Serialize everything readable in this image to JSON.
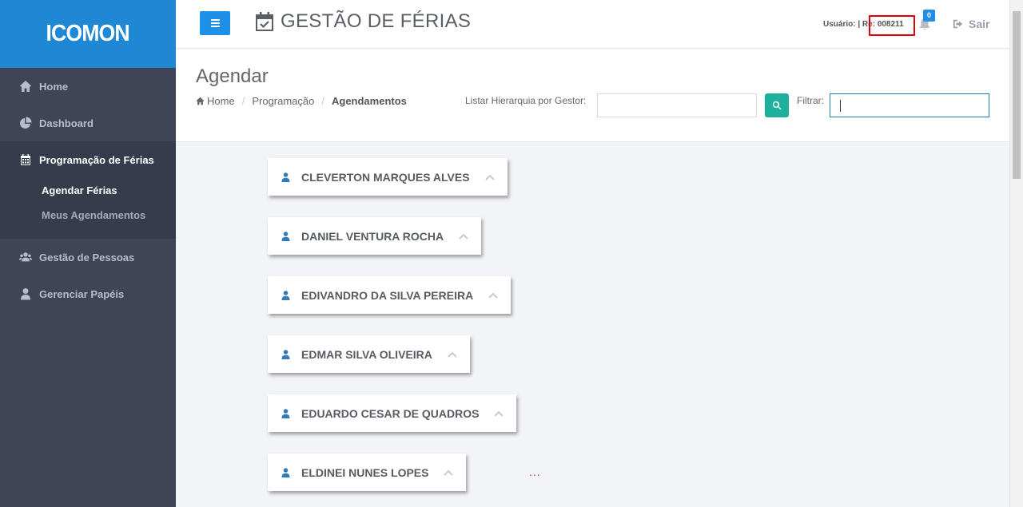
{
  "brand": {
    "logo_text": "ICOMON",
    "logo_color": "#1e88d4"
  },
  "sidebar": {
    "items": [
      {
        "label": "Home",
        "icon": "home-icon"
      },
      {
        "label": "Dashboard",
        "icon": "pie-chart-icon"
      },
      {
        "label": "Programação de Férias",
        "icon": "calendar-icon",
        "subitems": [
          {
            "label": "Agendar Férias"
          },
          {
            "label": "Meus Agendamentos"
          }
        ]
      },
      {
        "label": "Gestão de Pessoas",
        "icon": "users-icon"
      },
      {
        "label": "Gerenciar Papéis",
        "icon": "user-icon"
      }
    ]
  },
  "header": {
    "menu_icon": "hamburger-icon",
    "title_icon": "calendar-check-icon",
    "title": "GESTÃO DE FÉRIAS",
    "user_label": "Usuário: |",
    "user_re": "Re: 008211",
    "notification_count": "0",
    "logout_label": "Sair"
  },
  "page": {
    "title": "Agendar",
    "breadcrumb": [
      "Home",
      "Programação",
      "Agendamentos"
    ],
    "hierarchy_label": "Listar Hierarquia por Gestor:",
    "hierarchy_value": "",
    "filter_label": "Filtrar:",
    "filter_value": ""
  },
  "employees": [
    {
      "name": "CLEVERTON MARQUES ALVES"
    },
    {
      "name": "DANIEL VENTURA ROCHA"
    },
    {
      "name": "EDIVANDRO DA SILVA PEREIRA"
    },
    {
      "name": "EDMAR SILVA OLIVEIRA"
    },
    {
      "name": "EDUARDO CESAR DE QUADROS"
    },
    {
      "name": "ELDINEI NUNES LOPES"
    }
  ],
  "loading_text": "...",
  "colors": {
    "sidebar_bg": "#3d4557",
    "accent": "#1e90e8",
    "search_btn": "#1bb19c",
    "highlight": "#e00000"
  }
}
